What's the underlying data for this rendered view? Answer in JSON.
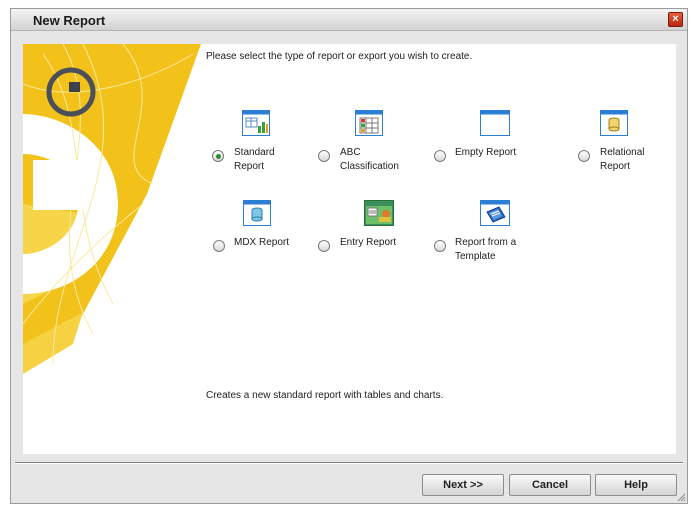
{
  "dialog": {
    "title": "New Report",
    "close_icon": "×"
  },
  "instruction": "Please select the type of report or export you wish to create.",
  "options": [
    {
      "label_1": "Standard",
      "label_2": "Report",
      "icon": "standard-report-icon",
      "selected": true
    },
    {
      "label_1": "ABC",
      "label_2": "Classification",
      "icon": "abc-classification-icon",
      "selected": false
    },
    {
      "label_1": "Empty Report",
      "label_2": "",
      "icon": "empty-report-icon",
      "selected": false
    },
    {
      "label_1": "Relational",
      "label_2": "Report",
      "icon": "relational-report-icon",
      "selected": false
    },
    {
      "label_1": "MDX Report",
      "label_2": "",
      "icon": "mdx-report-icon",
      "selected": false
    },
    {
      "label_1": "Entry Report",
      "label_2": "",
      "icon": "entry-report-icon",
      "selected": false
    },
    {
      "label_1": "Report from a",
      "label_2": "Template",
      "icon": "report-template-icon",
      "selected": false
    }
  ],
  "description": "Creates a new standard report with tables and charts.",
  "buttons": {
    "next": "Next >>",
    "cancel": "Cancel",
    "help": "Help"
  },
  "colors": {
    "accent_yellow": "#f0c419",
    "selected_radio": "#2f8f2a",
    "icon_blue": "#2a7fd4"
  }
}
